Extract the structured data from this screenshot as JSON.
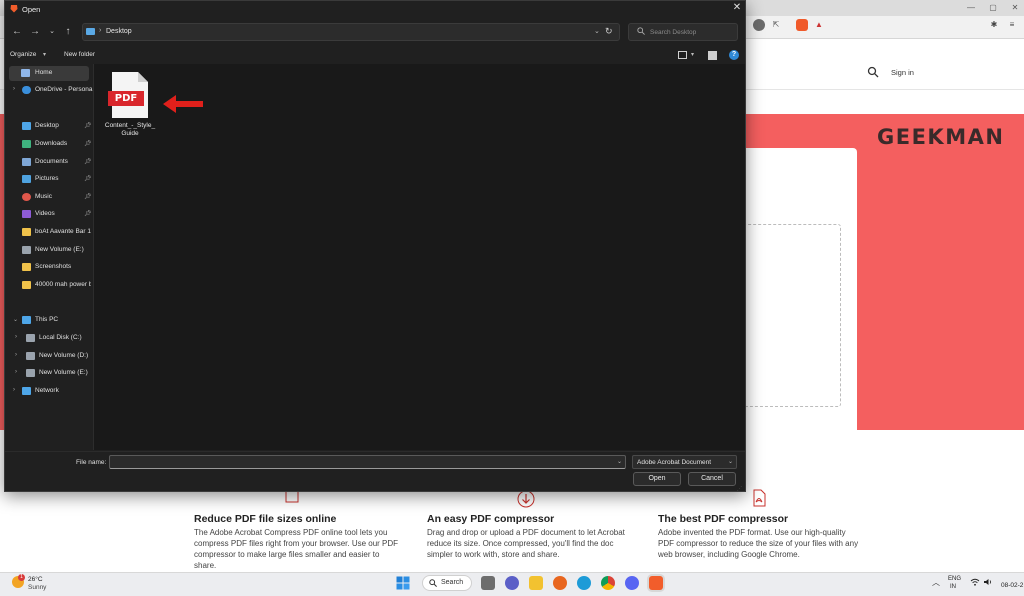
{
  "dialog": {
    "title": "Open",
    "address_path": "Desktop",
    "search_placeholder": "Search Desktop",
    "organize_label": "Organize",
    "new_folder_label": "New folder",
    "nav": [
      {
        "label": "Home",
        "icon": "home-icon",
        "selected": true
      },
      {
        "label": "OneDrive - Persona",
        "icon": "cloud-icon"
      },
      {
        "label": "Desktop",
        "icon": "desktop-folder-icon",
        "pinned": true
      },
      {
        "label": "Downloads",
        "icon": "download-icon",
        "pinned": true
      },
      {
        "label": "Documents",
        "icon": "documents-icon",
        "pinned": true
      },
      {
        "label": "Pictures",
        "icon": "pictures-icon",
        "pinned": true
      },
      {
        "label": "Music",
        "icon": "music-icon",
        "pinned": true
      },
      {
        "label": "Videos",
        "icon": "videos-icon",
        "pinned": true
      },
      {
        "label": "boAt Aavante Bar 1",
        "icon": "folder-icon"
      },
      {
        "label": "New Volume (E:)",
        "icon": "drive-icon"
      },
      {
        "label": "Screenshots",
        "icon": "folder-icon"
      },
      {
        "label": "40000 mah power b",
        "icon": "folder-icon"
      },
      {
        "label": "This PC",
        "icon": "computer-icon",
        "expanded": true
      },
      {
        "label": "Local Disk (C:)",
        "icon": "drive-icon"
      },
      {
        "label": "New Volume (D:)",
        "icon": "drive-icon"
      },
      {
        "label": "New Volume (E:)",
        "icon": "drive-icon"
      },
      {
        "label": "Network",
        "icon": "network-icon"
      }
    ],
    "file": {
      "badge": "PDF",
      "name_line1": "Content_-_Style_",
      "name_line2": "Guide"
    },
    "file_name_label": "File name:",
    "file_name_value": "",
    "file_type": "Adobe Acrobat Document",
    "open_label": "Open",
    "cancel_label": "Cancel"
  },
  "site": {
    "signin": "Sign in",
    "logo": "GEEKMAN",
    "features": [
      {
        "title": "Reduce PDF file sizes online",
        "body": "The Adobe Acrobat Compress PDF online tool lets you compress PDF files right from your browser. Use our PDF compressor to make large files smaller and easier to share."
      },
      {
        "title": "An easy PDF compressor",
        "body": "Drag and drop or upload a PDF document to let Acrobat reduce its size. Once compressed, you'll find the doc simpler to work with, store and share."
      },
      {
        "title": "The best PDF compressor",
        "body": "Adobe invented the PDF format. Use our high-quality PDF compressor to reduce the size of your files with any web browser, including Google Chrome."
      }
    ]
  },
  "taskbar": {
    "weather_temp": "26°C",
    "weather_cond": "Sunny",
    "weather_badge": "1",
    "search_label": "Search",
    "lang_line1": "ENG",
    "lang_line2": "IN",
    "date": "08-02-2"
  },
  "colors": {
    "accent_red": "#f45f5f",
    "dialog_bg": "#202020",
    "pdf_red": "#d9262c",
    "arrow_red": "#e0201b"
  }
}
